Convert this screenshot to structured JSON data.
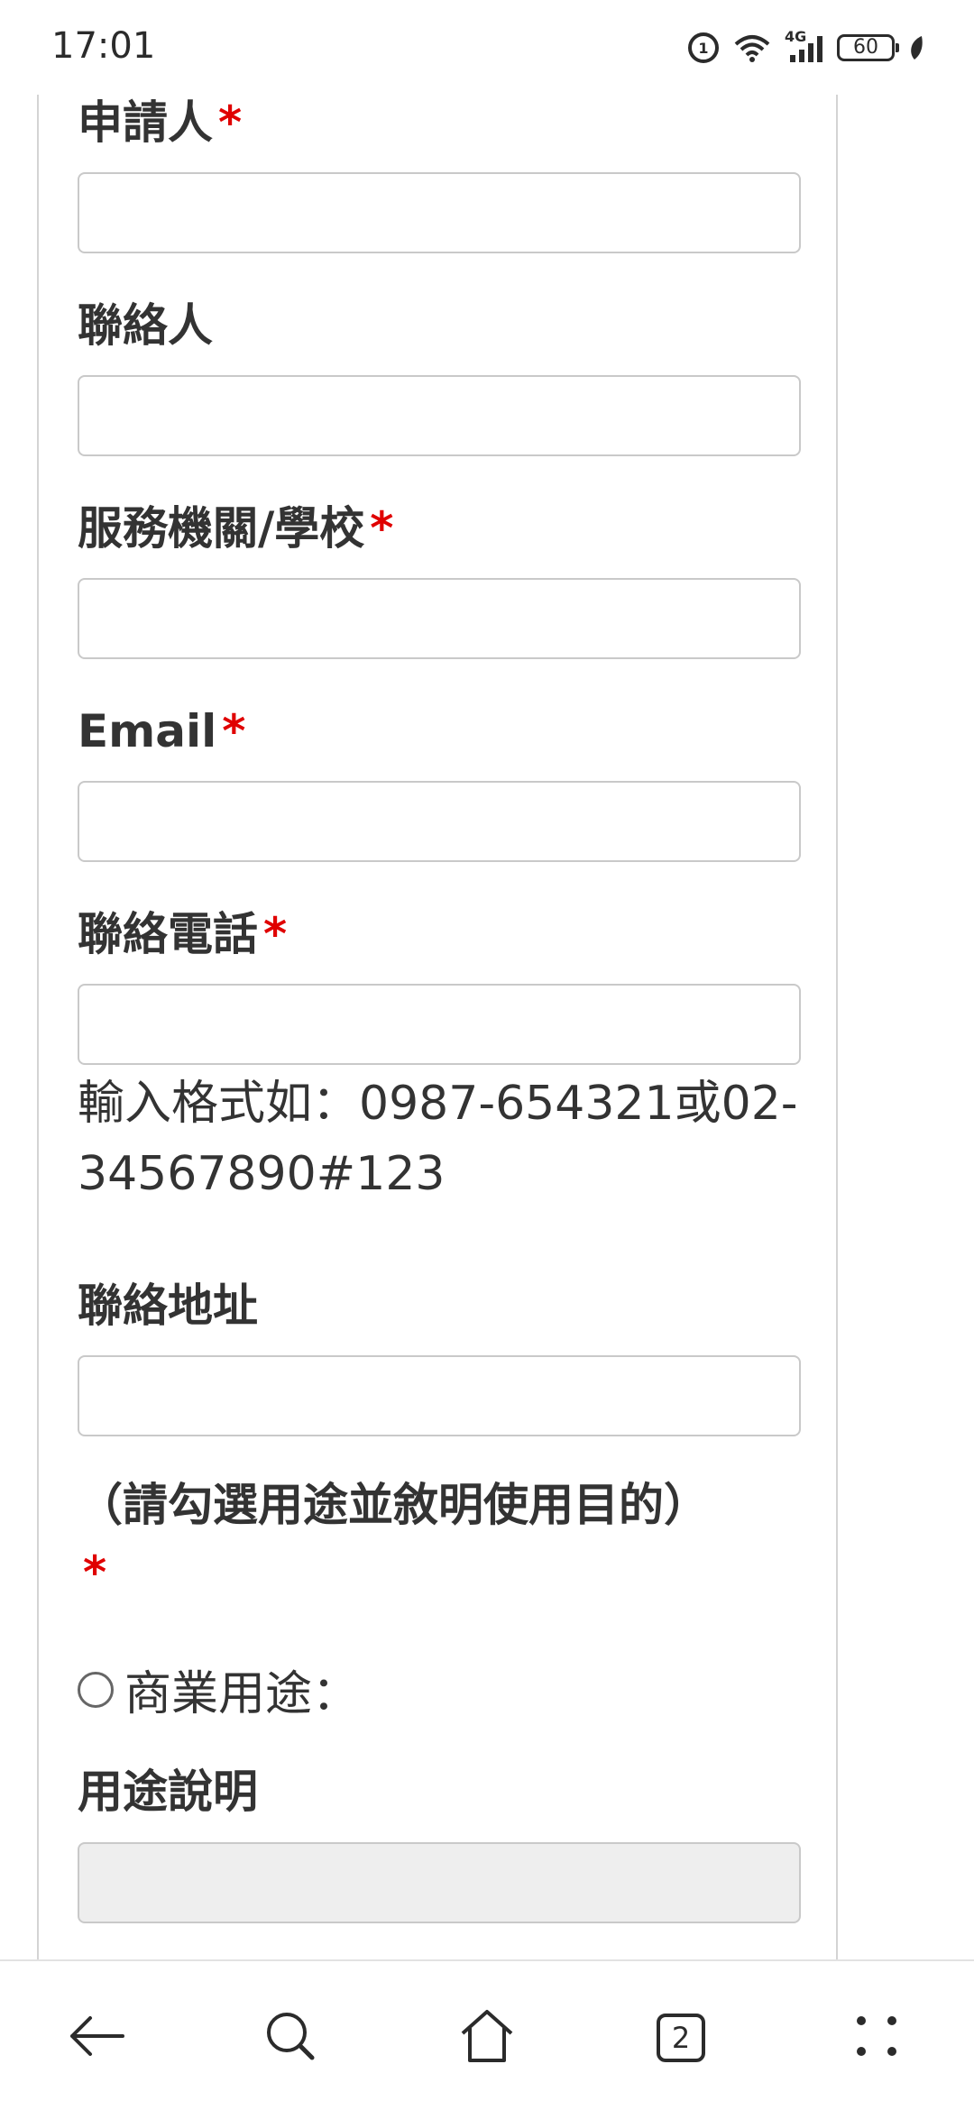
{
  "status_bar": {
    "time": "17:01",
    "network": "4G",
    "battery": "60",
    "icons": [
      "data-saver-icon",
      "wifi-icon",
      "cellular-signal-icon",
      "battery-icon",
      "leaf-icon"
    ]
  },
  "form": {
    "applicant_label": "申請人",
    "contact_person_label": "聯絡人",
    "organization_label": "服務機關/學校",
    "email_label": "Email",
    "phone_label": "聯絡電話",
    "phone_hint": "輸入格式如：0987-654321或02-34567890#123",
    "address_label": "聯絡地址",
    "purpose_instruction": "（請勾選用途並敘明使用目的）",
    "required_mark": "*",
    "commercial_option": "商業用途：",
    "usage_description_label": "用途說明"
  },
  "nav_bar": {
    "tab_count": "2",
    "icons": [
      "back-arrow-icon",
      "search-icon",
      "home-icon",
      "tabs-icon",
      "menu-icon"
    ]
  },
  "colors": {
    "required": "#e00000",
    "text": "#333333",
    "input_border": "#c9c9c9",
    "disabled_input": "#eeeeee"
  }
}
